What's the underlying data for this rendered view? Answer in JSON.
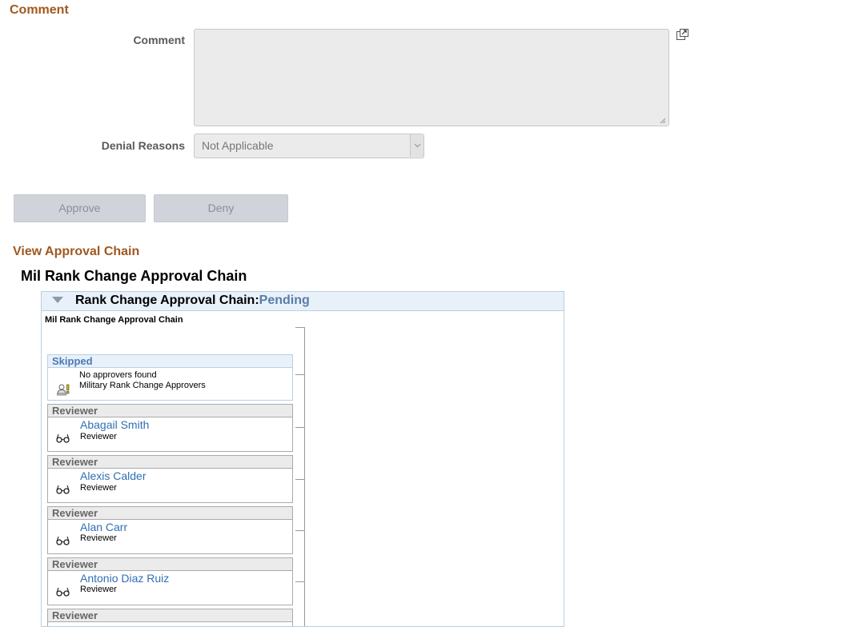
{
  "comment_section": {
    "title": "Comment",
    "comment_label": "Comment",
    "comment_value": "",
    "denial_label": "Denial Reasons",
    "denial_value": "Not Applicable"
  },
  "actions": {
    "approve_label": "Approve",
    "deny_label": "Deny"
  },
  "approval_chain": {
    "section_title": "View Approval Chain",
    "chain_title": "Mil Rank Change Approval Chain",
    "panel_title": "Rank Change Approval Chain:",
    "panel_status": "Pending",
    "sub_title": "Mil Rank Change Approval Chain",
    "skipped_step": {
      "header": "Skipped",
      "line1": "No approvers found",
      "line2": "Military Rank Change Approvers",
      "icon": "no-approver-warning-icon"
    },
    "reviewers": [
      {
        "header": "Reviewer",
        "name": "Abagail Smith",
        "role": "Reviewer",
        "icon": "glasses-icon"
      },
      {
        "header": "Reviewer",
        "name": "Alexis Calder",
        "role": "Reviewer",
        "icon": "glasses-icon"
      },
      {
        "header": "Reviewer",
        "name": "Alan Carr",
        "role": "Reviewer",
        "icon": "glasses-icon"
      },
      {
        "header": "Reviewer",
        "name": "Antonio Diaz Ruiz",
        "role": "Reviewer",
        "icon": "glasses-icon"
      },
      {
        "header": "Reviewer",
        "name": "",
        "role": "",
        "icon": "glasses-icon"
      }
    ]
  },
  "colors": {
    "section_title": "#a0581f",
    "link": "#2f6fb5",
    "status": "#5a7ca6"
  }
}
